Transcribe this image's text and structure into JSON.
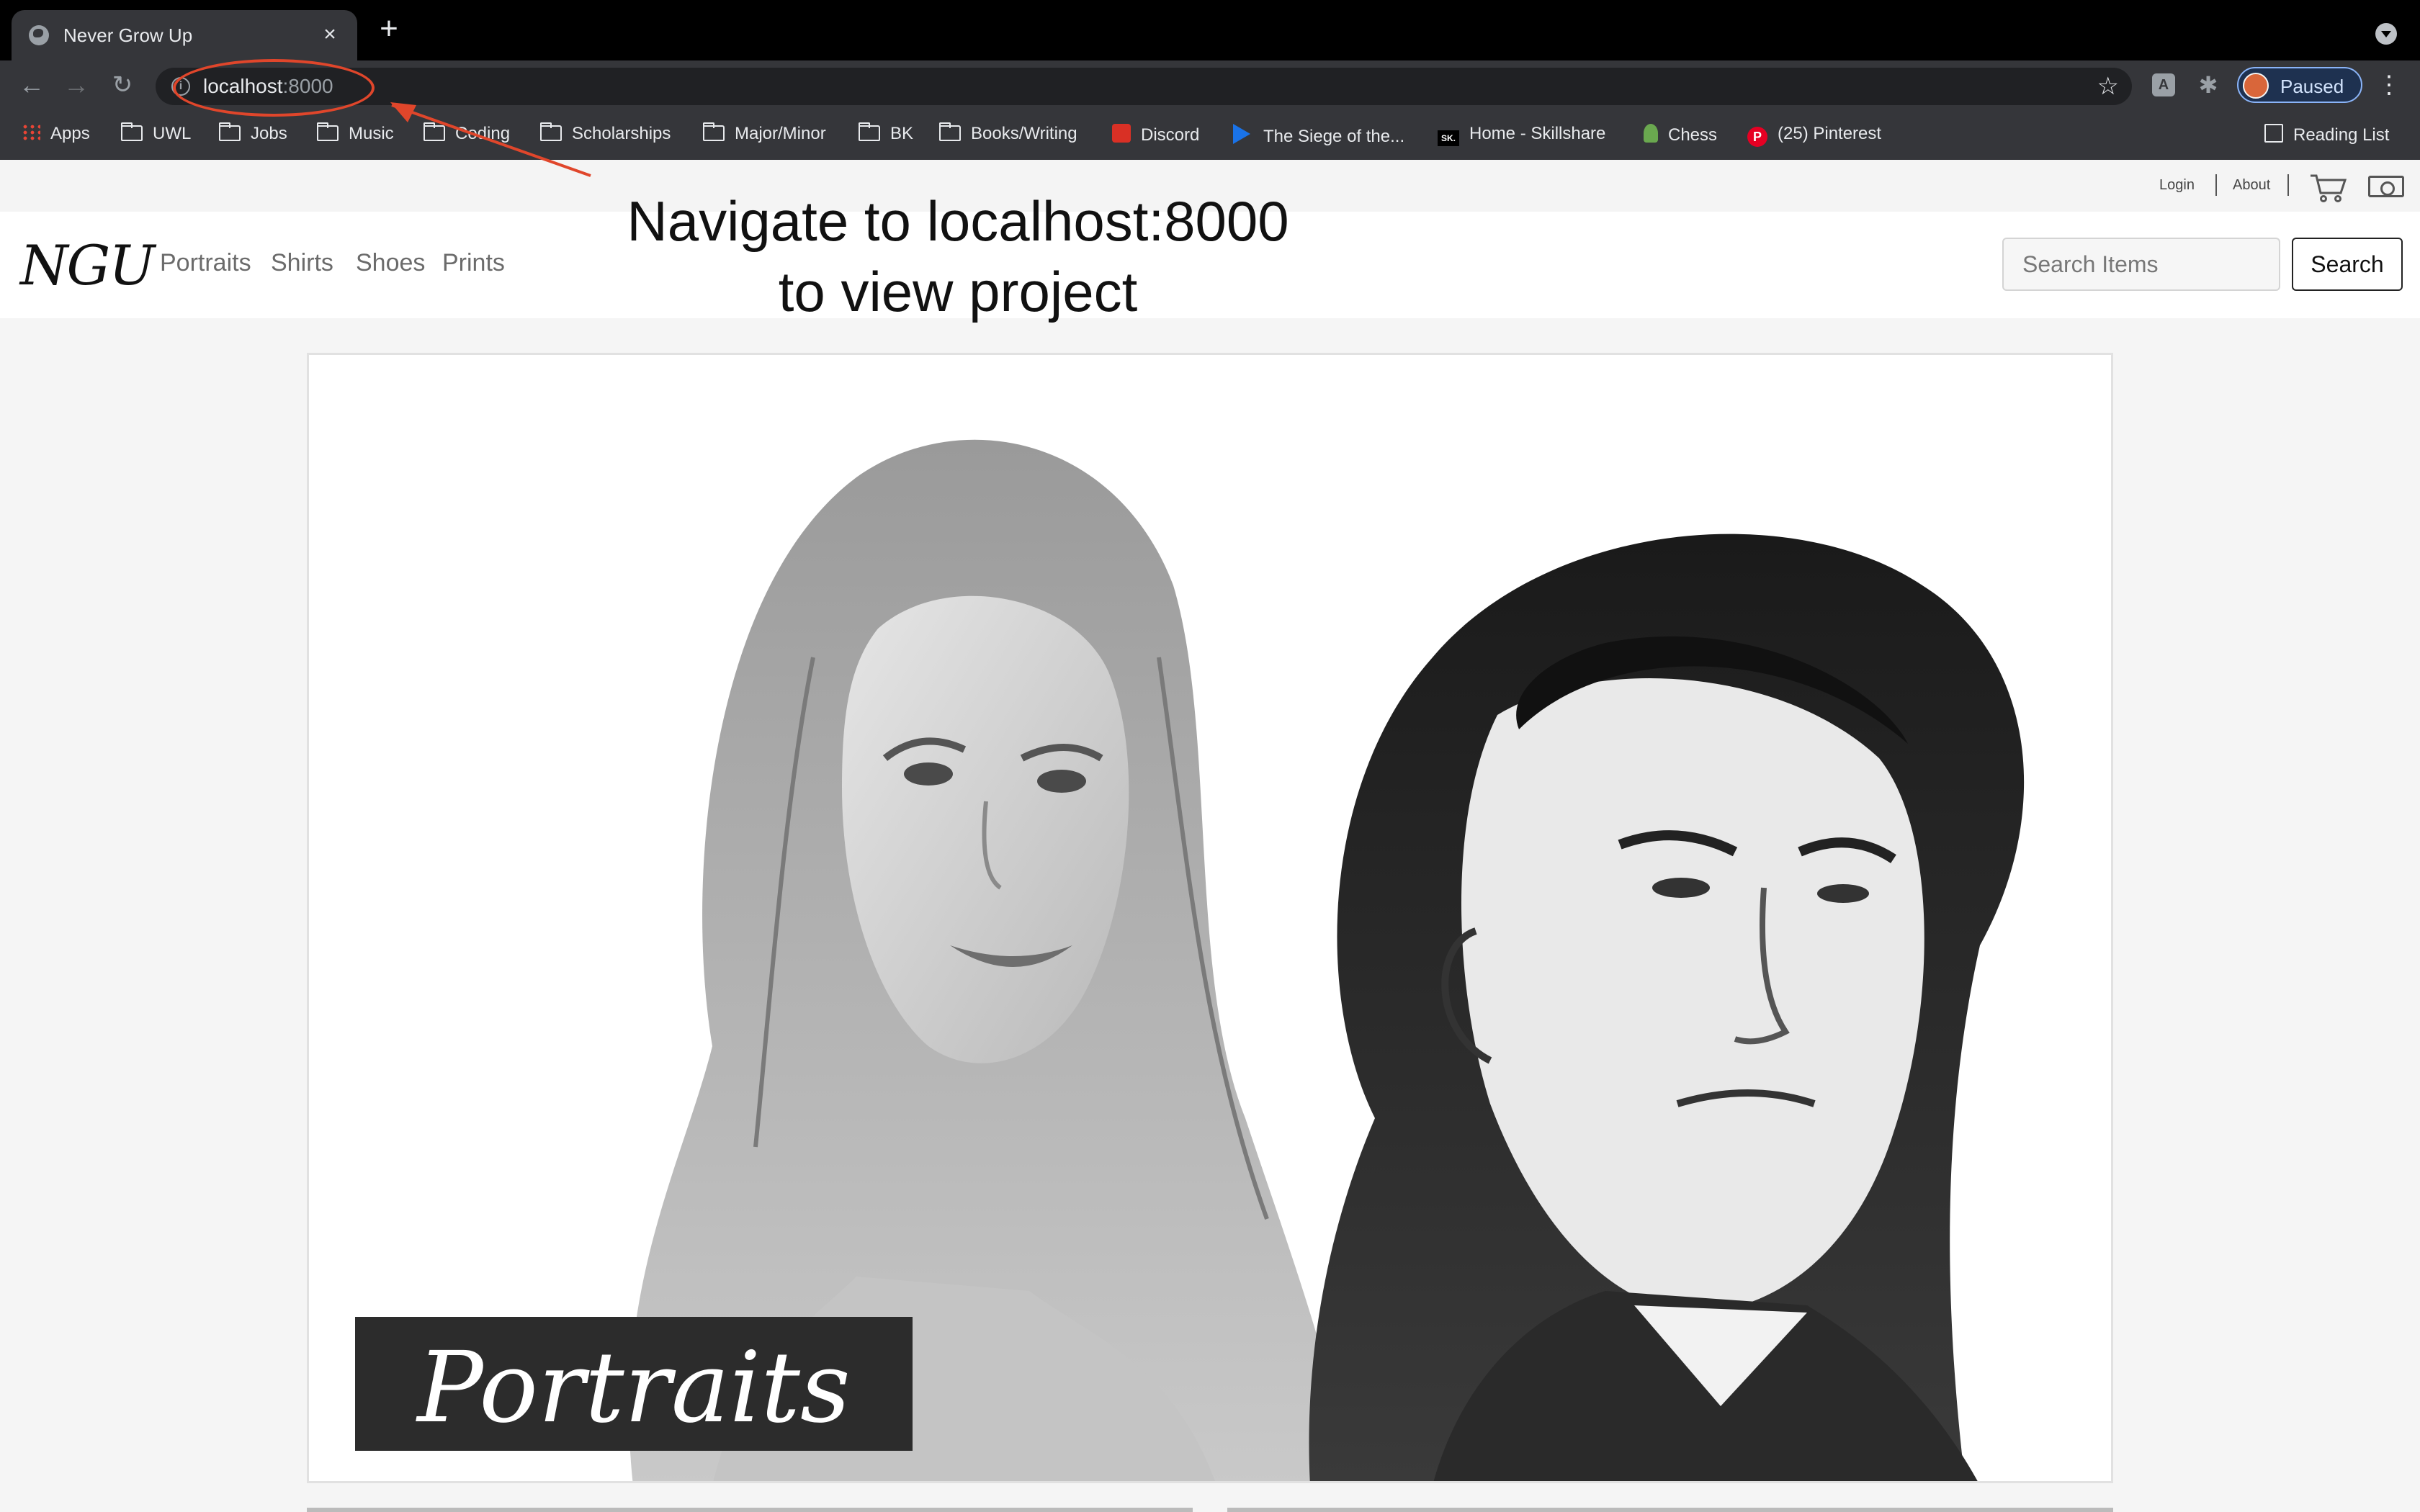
{
  "browser": {
    "tab_title": "Never Grow Up",
    "tab_close": "×",
    "new_tab": "+",
    "url_host": "localhost",
    "url_port": ":8000",
    "profile_label": "Paused",
    "bookmarks": [
      {
        "label": "Apps",
        "icon": "apps-grid-icon"
      },
      {
        "label": "UWL",
        "icon": "folder-icon"
      },
      {
        "label": "Jobs",
        "icon": "folder-icon"
      },
      {
        "label": "Music",
        "icon": "folder-icon"
      },
      {
        "label": "Coding",
        "icon": "folder-icon"
      },
      {
        "label": "Scholarships",
        "icon": "folder-icon"
      },
      {
        "label": "Major/Minor",
        "icon": "folder-icon"
      },
      {
        "label": "BK",
        "icon": "folder-icon"
      },
      {
        "label": "Books/Writing",
        "icon": "folder-icon"
      },
      {
        "label": "Discord",
        "icon": "discord-icon"
      },
      {
        "label": "The Siege of the...",
        "icon": "play-icon"
      },
      {
        "label": "Home - Skillshare",
        "icon": "skillshare-icon"
      },
      {
        "label": "Chess",
        "icon": "chess-pawn-icon"
      },
      {
        "label": "(25) Pinterest",
        "icon": "pinterest-icon"
      }
    ],
    "reading_list": "Reading List"
  },
  "site": {
    "utility": {
      "login": "Login",
      "about": "About"
    },
    "brand": "NGU",
    "nav": [
      "Portraits",
      "Shirts",
      "Shoes",
      "Prints"
    ],
    "search_placeholder": "Search Items",
    "search_button": "Search",
    "hero_caption": "Portraits"
  },
  "annotation": {
    "line1": "Navigate to localhost:8000",
    "line2": "to view project",
    "color": "#e0462b"
  }
}
